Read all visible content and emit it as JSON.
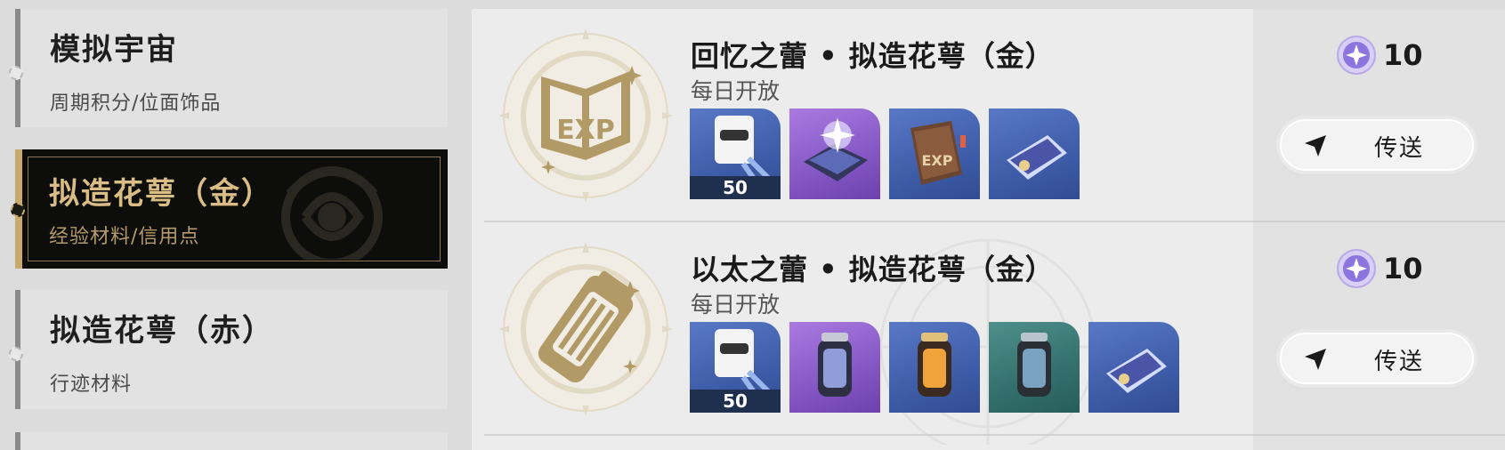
{
  "categories": [
    {
      "title": "模拟宇宙",
      "subtitle": "周期积分/位面饰品",
      "active": false
    },
    {
      "title": "拟造花萼（金）",
      "subtitle": "经验材料/信用点",
      "active": true
    },
    {
      "title": "拟造花萼（赤）",
      "subtitle": "行迹材料",
      "active": false
    }
  ],
  "entries": [
    {
      "title": "回忆之蕾 • 拟造花萼（金）",
      "availability": "每日开放",
      "cost": "10",
      "teleport_label": "传送",
      "emblem_icon": "exp-book-emblem-icon",
      "rewards": [
        {
          "icon": "trailblaze-exp-icon",
          "quantity": "50",
          "bg": "blue"
        },
        {
          "icon": "travel-encounters-book-icon",
          "bg": "purple"
        },
        {
          "icon": "adventure-log-book-icon",
          "bg": "blue"
        },
        {
          "icon": "credit-card-icon",
          "bg": "blue"
        }
      ]
    },
    {
      "title": "以太之蕾 • 拟造花萼（金）",
      "availability": "每日开放",
      "cost": "10",
      "teleport_label": "传送",
      "emblem_icon": "light-cone-canister-emblem-icon",
      "rewards": [
        {
          "icon": "trailblaze-exp-icon",
          "quantity": "50",
          "bg": "blue"
        },
        {
          "icon": "refined-aether-icon",
          "bg": "purple"
        },
        {
          "icon": "condensed-aether-icon",
          "bg": "blue"
        },
        {
          "icon": "sparse-aether-icon",
          "bg": "teal"
        },
        {
          "icon": "credit-card-icon",
          "bg": "blue"
        }
      ]
    }
  ],
  "colors": {
    "active_bg": "#0d0d0b",
    "active_gold": "#d9bd84",
    "rare_blue": "#3e5ca8",
    "epic_purple": "#8457c4",
    "uncommon_teal": "#33706d"
  }
}
